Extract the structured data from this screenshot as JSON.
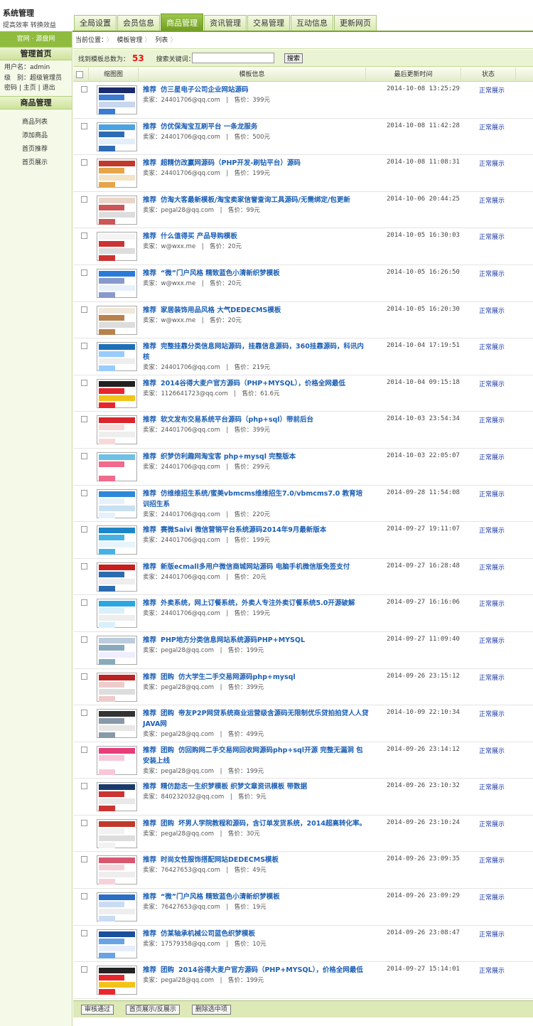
{
  "header": {
    "title": "系统管理",
    "subtitle": "提高效率 转换效益",
    "tabs": [
      "全局设置",
      "会员信息",
      "商品管理",
      "资讯管理",
      "交易管理",
      "互动信息",
      "更新网页"
    ],
    "active_tab": 2
  },
  "sidebar": {
    "links": [
      "官网",
      "源盘网"
    ],
    "home_title": "管理首页",
    "user_label": "用户名：admin",
    "level_label": "级　别：超级管理员",
    "links2": [
      "密码",
      "主页",
      "退出"
    ],
    "section_title": "商品管理",
    "menu": [
      "商品列表",
      "添加商品",
      "首页推荐",
      "首页展示"
    ]
  },
  "breadcrumb": {
    "label": "当前位置：",
    "items": [
      "模板管理",
      "列表"
    ]
  },
  "search": {
    "count_label": "找到模板总数为：",
    "count": "53",
    "keyword_label": "搜索关键词：",
    "button": "搜索",
    "placeholder": ""
  },
  "table": {
    "columns": [
      "缩图图",
      "模板信息",
      "最后更新时间",
      "状态"
    ],
    "rows": [
      {
        "tags": [
          "推荐"
        ],
        "title": "仿三星电子公司企业网站源码",
        "seller": "卖家：24401706@qq.com",
        "price": "售价：399元",
        "time": "2014-10-08 13:25:29",
        "status": "正常展示"
      },
      {
        "tags": [
          "推荐"
        ],
        "title": "仿优保淘宝互刷平台 一条龙服务",
        "seller": "卖家：24401706@qq.com",
        "price": "售价：500元",
        "time": "2014-10-08 11:42:28",
        "status": "正常展示"
      },
      {
        "tags": [
          "推荐"
        ],
        "title": "超精仿改赢网源码（PHP开发-刷钻平台）源码",
        "seller": "卖家：24401706@qq.com",
        "price": "售价：199元",
        "time": "2014-10-08 11:08:31",
        "status": "正常展示"
      },
      {
        "tags": [
          "推荐"
        ],
        "title": "仿淘大客最新模板/淘宝卖家信誉查询工具源码/无需绑定/包更新",
        "seller": "卖家：pegal28@qq.com",
        "price": "售价：99元",
        "time": "2014-10-06 20:44:25",
        "status": "正常展示"
      },
      {
        "tags": [
          "推荐"
        ],
        "title": "什么值得买 产品导购模板",
        "seller": "卖家：w@wxx.me",
        "price": "售价：20元",
        "time": "2014-10-05 16:30:03",
        "status": "正常展示"
      },
      {
        "tags": [
          "推荐"
        ],
        "title": "“微”门户风格 精致蓝色小清新织梦模板",
        "seller": "卖家：w@wxx.me",
        "price": "售价：20元",
        "time": "2014-10-05 16:26:50",
        "status": "正常展示"
      },
      {
        "tags": [
          "推荐"
        ],
        "title": "家居装饰用品风格 大气DEDECMS模板",
        "seller": "卖家：w@wxx.me",
        "price": "售价：20元",
        "time": "2014-10-05 16:20:30",
        "status": "正常展示"
      },
      {
        "tags": [
          "推荐"
        ],
        "title": "完整挂靠分类信息网站源码，挂靠信息源码，360挂靠源码，科讯内核",
        "seller": "卖家：24401706@qq.com",
        "price": "售价：219元",
        "time": "2014-10-04 17:19:51",
        "status": "正常展示"
      },
      {
        "tags": [
          "推荐"
        ],
        "title": "2014谷得大麦户官方源码（PHP+MYSQL），价格全网最低",
        "seller": "卖家：1126641723@qq.com",
        "price": "售价：61.6元",
        "time": "2014-10-04 09:15:18",
        "status": "正常展示"
      },
      {
        "tags": [
          "推荐"
        ],
        "title": "软文发布交易系统平台源码（php+sql）带前后台",
        "seller": "卖家：24401706@qq.com",
        "price": "售价：399元",
        "time": "2014-10-03 23:54:34",
        "status": "正常展示"
      },
      {
        "tags": [
          "推荐"
        ],
        "title": "织梦仿利趣网淘宝客 php+mysql 完整版本",
        "seller": "卖家：24401706@qq.com",
        "price": "售价：299元",
        "time": "2014-10-03 22:05:07",
        "status": "正常展示"
      },
      {
        "tags": [
          "推荐"
        ],
        "title": "仿维维招生系统/蜜美vbmcms维维招生7.0/vbmcms7.0 教育培训招生系",
        "seller": "卖家：24401706@qq.com",
        "price": "售价：220元",
        "time": "2014-09-28 11:54:08",
        "status": "正常展示"
      },
      {
        "tags": [
          "推荐"
        ],
        "title": "赛微Saivi 微信营销平台系统源码2014年9月最新版本",
        "seller": "卖家：24401706@qq.com",
        "price": "售价：199元",
        "time": "2014-09-27 19:11:07",
        "status": "正常展示"
      },
      {
        "tags": [
          "推荐"
        ],
        "title": "新版ecmall多用户微信商城网站源码 电脑手机微信版免签支付",
        "seller": "卖家：24401706@qq.com",
        "price": "售价：20元",
        "time": "2014-09-27 16:28:48",
        "status": "正常展示"
      },
      {
        "tags": [
          "推荐"
        ],
        "title": "外卖系统，网上订餐系统，外卖人专注外卖订餐系统5.0开源破解",
        "seller": "卖家：24401706@qq.com",
        "price": "售价：199元",
        "time": "2014-09-27 16:16:06",
        "status": "正常展示"
      },
      {
        "tags": [
          "推荐"
        ],
        "title": "PHP地方分类信息网站系统源码PHP+MYSQL",
        "seller": "卖家：pegal28@qq.com",
        "price": "售价：199元",
        "time": "2014-09-27 11:09:40",
        "status": "正常展示"
      },
      {
        "tags": [
          "推荐",
          "团购"
        ],
        "title": "仿大学生二手交易网源码php+mysql",
        "seller": "卖家：pegal28@qq.com",
        "price": "售价：399元",
        "time": "2014-09-26 23:15:12",
        "status": "正常展示"
      },
      {
        "tags": [
          "推荐",
          "团购"
        ],
        "title": "帝友P2P网贷系统商业运营级含源码无限制优乐贷拍拍贷人人贷JAVA网",
        "seller": "卖家：pegal28@qq.com",
        "price": "售价：499元",
        "time": "2014-10-09 22:10:34",
        "status": "正常展示"
      },
      {
        "tags": [
          "推荐",
          "团购"
        ],
        "title": "仿回购网二手交易网回收网源码php+sql开源 完整无漏洞 包安装上线",
        "seller": "卖家：pegal28@qq.com",
        "price": "售价：199元",
        "time": "2014-09-26 23:14:12",
        "status": "正常展示"
      },
      {
        "tags": [
          "推荐"
        ],
        "title": "精仿励志一生织梦模板 织梦文章资讯模板 带数据",
        "seller": "卖家：840232032@qq.com",
        "price": "售价：9元",
        "time": "2014-09-26 23:10:32",
        "status": "正常展示"
      },
      {
        "tags": [
          "推荐",
          "团购"
        ],
        "title": "坏男人学院教程和源码，含订单发货系统，2014超高转化率。",
        "seller": "卖家：pegal28@qq.com",
        "price": "售价：30元",
        "time": "2014-09-26 23:10:24",
        "status": "正常展示"
      },
      {
        "tags": [
          "推荐"
        ],
        "title": "时尚女性服饰搭配网站DEDECMS模板",
        "seller": "卖家：76427653@qq.com",
        "price": "售价：49元",
        "time": "2014-09-26 23:09:35",
        "status": "正常展示"
      },
      {
        "tags": [
          "推荐"
        ],
        "title": "“微”门户风格 精致蓝色小清新织梦模板",
        "seller": "卖家：76427653@qq.com",
        "price": "售价：19元",
        "time": "2014-09-26 23:09:29",
        "status": "正常展示"
      },
      {
        "tags": [
          "推荐"
        ],
        "title": "仿某轴承机械公司蓝色织梦模板",
        "seller": "卖家：17579358@qq.com",
        "price": "售价：10元",
        "time": "2014-09-26 23:08:47",
        "status": "正常展示"
      },
      {
        "tags": [
          "推荐",
          "团购"
        ],
        "title": "2014谷得大麦户官方源码（PHP+MYSQL），价格全网最低",
        "seller": "卖家：pegal28@qq.com",
        "price": "售价：199元",
        "time": "2014-09-27 15:14:01",
        "status": "正常展示"
      }
    ]
  },
  "actions": [
    "审核通过",
    "首页展示/反展示",
    "删除选中项"
  ],
  "colors": {
    "accent": "#7aa52a",
    "link": "#1b5fb5",
    "status": "#1b39a8",
    "count": "#e11111"
  }
}
